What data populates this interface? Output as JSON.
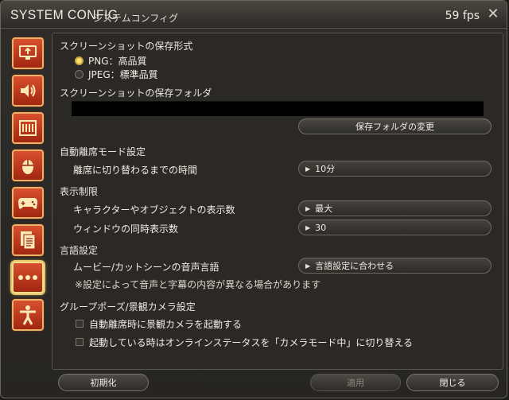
{
  "window": {
    "title": "SYSTEM CONFIG",
    "subtitle": "システムコンフィグ",
    "fps": "59 fps"
  },
  "sidebar": {
    "items": [
      {
        "name": "display",
        "icon": "monitor-icon"
      },
      {
        "name": "sound",
        "icon": "speaker-icon"
      },
      {
        "name": "theme",
        "icon": "frame-icon"
      },
      {
        "name": "mouse",
        "icon": "mouse-icon"
      },
      {
        "name": "gamepad",
        "icon": "gamepad-icon"
      },
      {
        "name": "log",
        "icon": "document-icon"
      },
      {
        "name": "other",
        "icon": "ellipsis-icon"
      },
      {
        "name": "accessibility",
        "icon": "person-icon"
      }
    ],
    "active_index": 6
  },
  "screenshot": {
    "format_label": "スクリーンショットの保存形式",
    "options": [
      "PNG：高品質",
      "JPEG：標準品質"
    ],
    "selected": 0,
    "folder_label": "スクリーンショットの保存フォルダ",
    "folder_path": "",
    "change_folder_button": "保存フォルダの変更"
  },
  "afk": {
    "section": "自動離席モード設定",
    "label": "離席に切り替わるまでの時間",
    "value": "10分"
  },
  "display_limits": {
    "section": "表示制限",
    "characters_label": "キャラクターやオブジェクトの表示数",
    "characters_value": "最大",
    "windows_label": "ウィンドウの同時表示数",
    "windows_value": "30"
  },
  "language": {
    "section": "言語設定",
    "movie_label": "ムービー/カットシーンの音声言語",
    "movie_value": "言語設定に合わせる",
    "note": "※設定によって音声と字幕の内容が異なる場合があります"
  },
  "group_pose": {
    "section": "グループポーズ/景観カメラ設定",
    "check1": "自動離席時に景観カメラを起動する",
    "check2": "起動している時はオンラインステータスを「カメラモード中」に切り替える"
  },
  "footer": {
    "reset": "初期化",
    "apply": "適用",
    "close": "閉じる"
  }
}
